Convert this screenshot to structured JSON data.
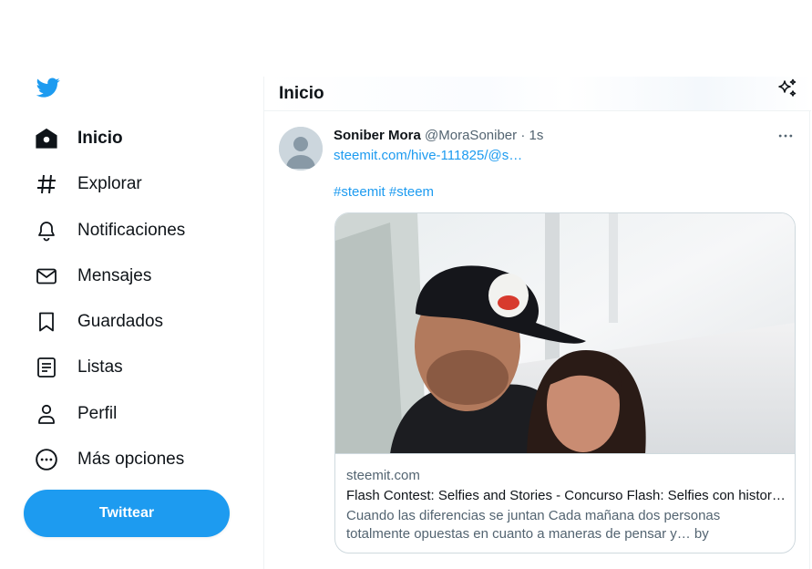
{
  "sidebar": {
    "items": [
      {
        "label": "Inicio",
        "icon": "home-icon",
        "active": true
      },
      {
        "label": "Explorar",
        "icon": "hashtag-icon"
      },
      {
        "label": "Notificaciones",
        "icon": "bell-icon"
      },
      {
        "label": "Mensajes",
        "icon": "mail-icon"
      },
      {
        "label": "Guardados",
        "icon": "bookmark-icon"
      },
      {
        "label": "Listas",
        "icon": "list-icon"
      },
      {
        "label": "Perfil",
        "icon": "person-icon"
      },
      {
        "label": "Más opciones",
        "icon": "more-circle-icon"
      }
    ],
    "tweet_button": "Twittear"
  },
  "header": {
    "title": "Inicio"
  },
  "tweet": {
    "author_name": "Soniber Mora",
    "author_handle": "@MoraSoniber",
    "separator": "·",
    "time": "1s",
    "link": "steemit.com/hive-111825/@s…",
    "hashtags": "#steemit #steem",
    "card": {
      "domain": "steemit.com",
      "title": "Flash Contest: Selfies and Stories - Concurso Flash: Selfies con histor…",
      "description": "Cuando las diferencias se juntan Cada mañana dos personas totalmente opuestas en cuanto a maneras de pensar y… by sonibermora"
    }
  },
  "colors": {
    "accent": "#1d9bf0",
    "text_primary": "#0f1419",
    "text_secondary": "#536471",
    "border": "#eff3f4"
  }
}
